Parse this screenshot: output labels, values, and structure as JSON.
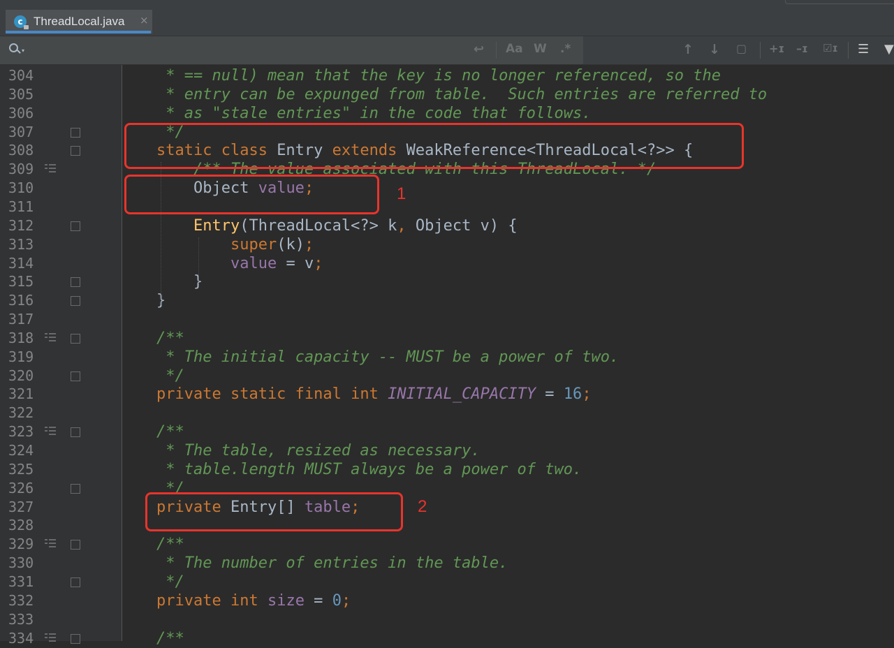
{
  "tab": {
    "title": "ThreadLocal.java",
    "icon": "c",
    "close": "×"
  },
  "search": {
    "placeholder": "",
    "match_case": "Aa",
    "words": "W",
    "regex": ".*"
  },
  "annotations": {
    "one": "1",
    "two": "2"
  },
  "lines": [
    {
      "n": "304",
      "bm": false,
      "fold": false,
      "parts": [
        [
          "cm",
          " * == null) mean that the key is no longer referenced, so the"
        ]
      ]
    },
    {
      "n": "305",
      "bm": false,
      "fold": false,
      "parts": [
        [
          "cm",
          " * entry can be expunged from table.  Such entries are referred to"
        ]
      ]
    },
    {
      "n": "306",
      "bm": false,
      "fold": false,
      "parts": [
        [
          "cm",
          " * as \"stale entries\" in the code that follows."
        ]
      ]
    },
    {
      "n": "307",
      "bm": false,
      "fold": true,
      "parts": [
        [
          "cm",
          " */"
        ]
      ]
    },
    {
      "n": "308",
      "bm": false,
      "fold": true,
      "parts": [
        [
          "kw",
          "static class "
        ],
        [
          "pl",
          "Entry "
        ],
        [
          "kw",
          "extends "
        ],
        [
          "pl",
          "WeakReference<ThreadLocal<?>> {"
        ]
      ]
    },
    {
      "n": "309",
      "bm": true,
      "fold": false,
      "parts": [
        [
          "pl",
          "    "
        ],
        [
          "cm",
          "/** The value associated with this ThreadLocal. */"
        ]
      ]
    },
    {
      "n": "310",
      "bm": false,
      "fold": false,
      "parts": [
        [
          "pl",
          "    Object "
        ],
        [
          "fld",
          "value"
        ],
        [
          "sym",
          ";"
        ]
      ]
    },
    {
      "n": "311",
      "bm": false,
      "fold": false,
      "parts": []
    },
    {
      "n": "312",
      "bm": false,
      "fold": true,
      "parts": [
        [
          "pl",
          "    "
        ],
        [
          "fn",
          "Entry"
        ],
        [
          "pl",
          "(ThreadLocal<?> k"
        ],
        [
          "sym",
          ", "
        ],
        [
          "pl",
          "Object v) {"
        ]
      ]
    },
    {
      "n": "313",
      "bm": false,
      "fold": false,
      "parts": [
        [
          "pl",
          "        "
        ],
        [
          "kw",
          "super"
        ],
        [
          "pl",
          "(k)"
        ],
        [
          "sym",
          ";"
        ]
      ]
    },
    {
      "n": "314",
      "bm": false,
      "fold": false,
      "parts": [
        [
          "pl",
          "        "
        ],
        [
          "fld",
          "value"
        ],
        [
          "pl",
          " = v"
        ],
        [
          "sym",
          ";"
        ]
      ]
    },
    {
      "n": "315",
      "bm": false,
      "fold": true,
      "parts": [
        [
          "pl",
          "    }"
        ]
      ]
    },
    {
      "n": "316",
      "bm": false,
      "fold": true,
      "parts": [
        [
          "pl",
          "}"
        ]
      ]
    },
    {
      "n": "317",
      "bm": false,
      "fold": false,
      "parts": []
    },
    {
      "n": "318",
      "bm": true,
      "fold": true,
      "parts": [
        [
          "cm",
          "/**"
        ]
      ]
    },
    {
      "n": "319",
      "bm": false,
      "fold": false,
      "parts": [
        [
          "cm",
          " * The initial capacity -- MUST be a power of two."
        ]
      ]
    },
    {
      "n": "320",
      "bm": false,
      "fold": true,
      "parts": [
        [
          "cm",
          " */"
        ]
      ]
    },
    {
      "n": "321",
      "bm": false,
      "fold": false,
      "parts": [
        [
          "kw",
          "private static final int "
        ],
        [
          "cst",
          "INITIAL_CAPACITY"
        ],
        [
          "pl",
          " = "
        ],
        [
          "num",
          "16"
        ],
        [
          "sym",
          ";"
        ]
      ]
    },
    {
      "n": "322",
      "bm": false,
      "fold": false,
      "parts": []
    },
    {
      "n": "323",
      "bm": true,
      "fold": true,
      "parts": [
        [
          "cm",
          "/**"
        ]
      ]
    },
    {
      "n": "324",
      "bm": false,
      "fold": false,
      "parts": [
        [
          "cm",
          " * The table, resized as necessary."
        ]
      ]
    },
    {
      "n": "325",
      "bm": false,
      "fold": false,
      "parts": [
        [
          "cm",
          " * table.length MUST always be a power of two."
        ]
      ]
    },
    {
      "n": "326",
      "bm": false,
      "fold": true,
      "parts": [
        [
          "cm",
          " */"
        ]
      ]
    },
    {
      "n": "327",
      "bm": false,
      "fold": false,
      "parts": [
        [
          "kw",
          "private "
        ],
        [
          "pl",
          "Entry[] "
        ],
        [
          "fld",
          "table"
        ],
        [
          "sym",
          ";"
        ]
      ]
    },
    {
      "n": "328",
      "bm": false,
      "fold": false,
      "parts": []
    },
    {
      "n": "329",
      "bm": true,
      "fold": true,
      "parts": [
        [
          "cm",
          "/**"
        ]
      ]
    },
    {
      "n": "330",
      "bm": false,
      "fold": false,
      "parts": [
        [
          "cm",
          " * The number of entries in the table."
        ]
      ]
    },
    {
      "n": "331",
      "bm": false,
      "fold": true,
      "parts": [
        [
          "cm",
          " */"
        ]
      ]
    },
    {
      "n": "332",
      "bm": false,
      "fold": false,
      "parts": [
        [
          "kw",
          "private int "
        ],
        [
          "fld",
          "size"
        ],
        [
          "pl",
          " = "
        ],
        [
          "num",
          "0"
        ],
        [
          "sym",
          ";"
        ]
      ]
    },
    {
      "n": "333",
      "bm": false,
      "fold": false,
      "parts": []
    },
    {
      "n": "334",
      "bm": true,
      "fold": true,
      "parts": [
        [
          "cm",
          "/**"
        ]
      ]
    }
  ]
}
